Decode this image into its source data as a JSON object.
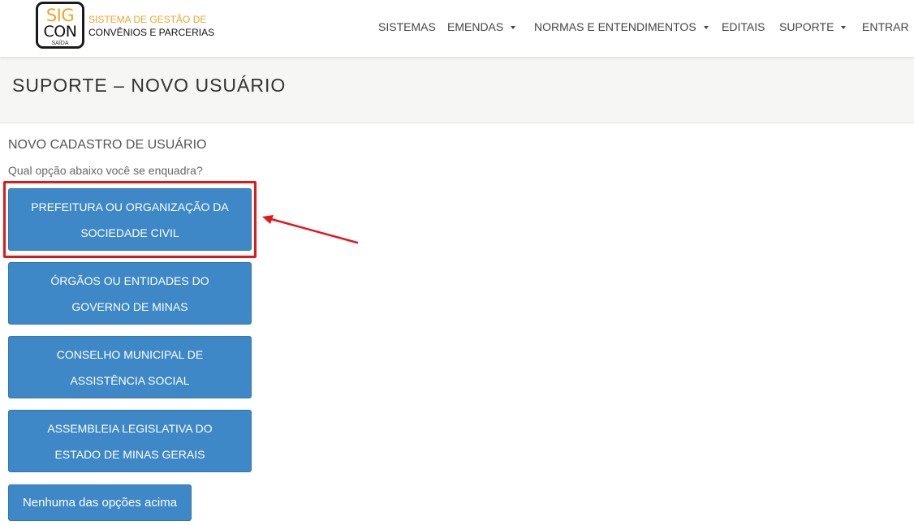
{
  "logo": {
    "sig": "SIG",
    "con": "CON",
    "saida": "SAÍDA",
    "line1": "SISTEMA DE GESTÃO DE",
    "line2": "CONVÊNIOS E PARCERIAS"
  },
  "nav": {
    "items": [
      "SISTEMAS",
      "EMENDAS",
      "NORMAS E ENTENDIMENTOS",
      "EDITAIS",
      "SUPORTE",
      "ENTRAR"
    ]
  },
  "page": {
    "title": "SUPORTE – NOVO USUÁRIO",
    "section_title": "NOVO CADASTRO DE USUÁRIO",
    "question": "Qual opção abaixo você se enquadra?"
  },
  "options": [
    {
      "line1": "PREFEITURA OU ORGANIZAÇÃO DA",
      "line2": "SOCIEDADE CIVIL"
    },
    {
      "line1": "ÓRGÃOS OU ENTIDADES DO",
      "line2": "GOVERNO DE MINAS"
    },
    {
      "line1": "CONSELHO MUNICIPAL DE",
      "line2": "ASSISTÊNCIA SOCIAL"
    },
    {
      "line1": "ASSEMBLEIA LEGISLATIVA DO",
      "line2": "ESTADO DE MINAS GERAIS"
    }
  ],
  "none_option": "Nenhuma das opções acima",
  "colors": {
    "button": "#3f88c8",
    "logo_accent": "#f0a52a",
    "annotation": "#e3161b"
  }
}
